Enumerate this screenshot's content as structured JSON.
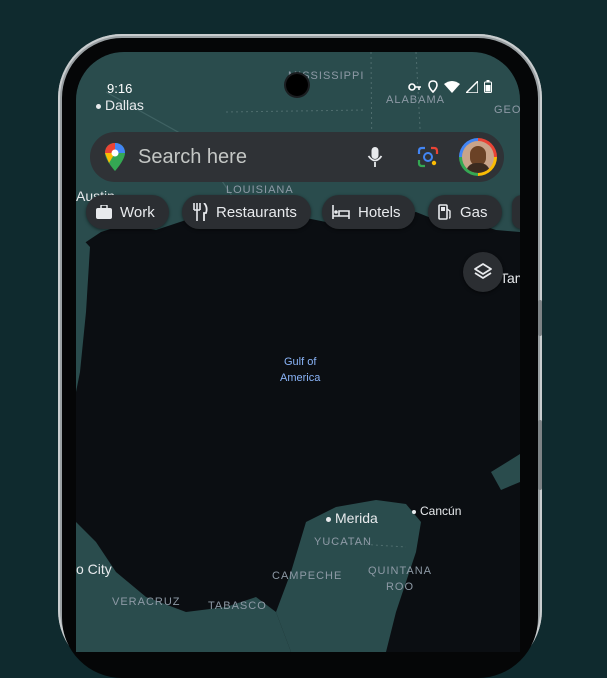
{
  "status_bar": {
    "time": "9:16"
  },
  "search": {
    "placeholder": "Search here"
  },
  "chips": [
    {
      "label": "Work",
      "icon": "briefcase-icon"
    },
    {
      "label": "Restaurants",
      "icon": "fork-knife-icon"
    },
    {
      "label": "Hotels",
      "icon": "bed-icon"
    },
    {
      "label": "Gas",
      "icon": "gas-pump-icon"
    }
  ],
  "map": {
    "water_label": "Gulf of\nAmerica",
    "regions": {
      "mississippi": "MISSISSIPPI",
      "alabama": "ALABAMA",
      "louisiana": "LOUISIANA",
      "geo": "GEO",
      "yucatan": "YUCATAN",
      "campeche": "CAMPECHE",
      "quintana": "QUINTANA\nROO",
      "veracruz": "VERACRUZ",
      "tabasco": "TABASCO"
    },
    "cities": {
      "dallas": "Dallas",
      "austin": "Austin",
      "tampa": "Tam",
      "merida": "Merida",
      "cancun": "Cancún",
      "mexico_city": "o City"
    }
  },
  "colors": {
    "land": "#2a4c4d",
    "water": "#0b0e12",
    "chip_bg": "#2b2e32",
    "bezel": "#9aa0a3"
  }
}
